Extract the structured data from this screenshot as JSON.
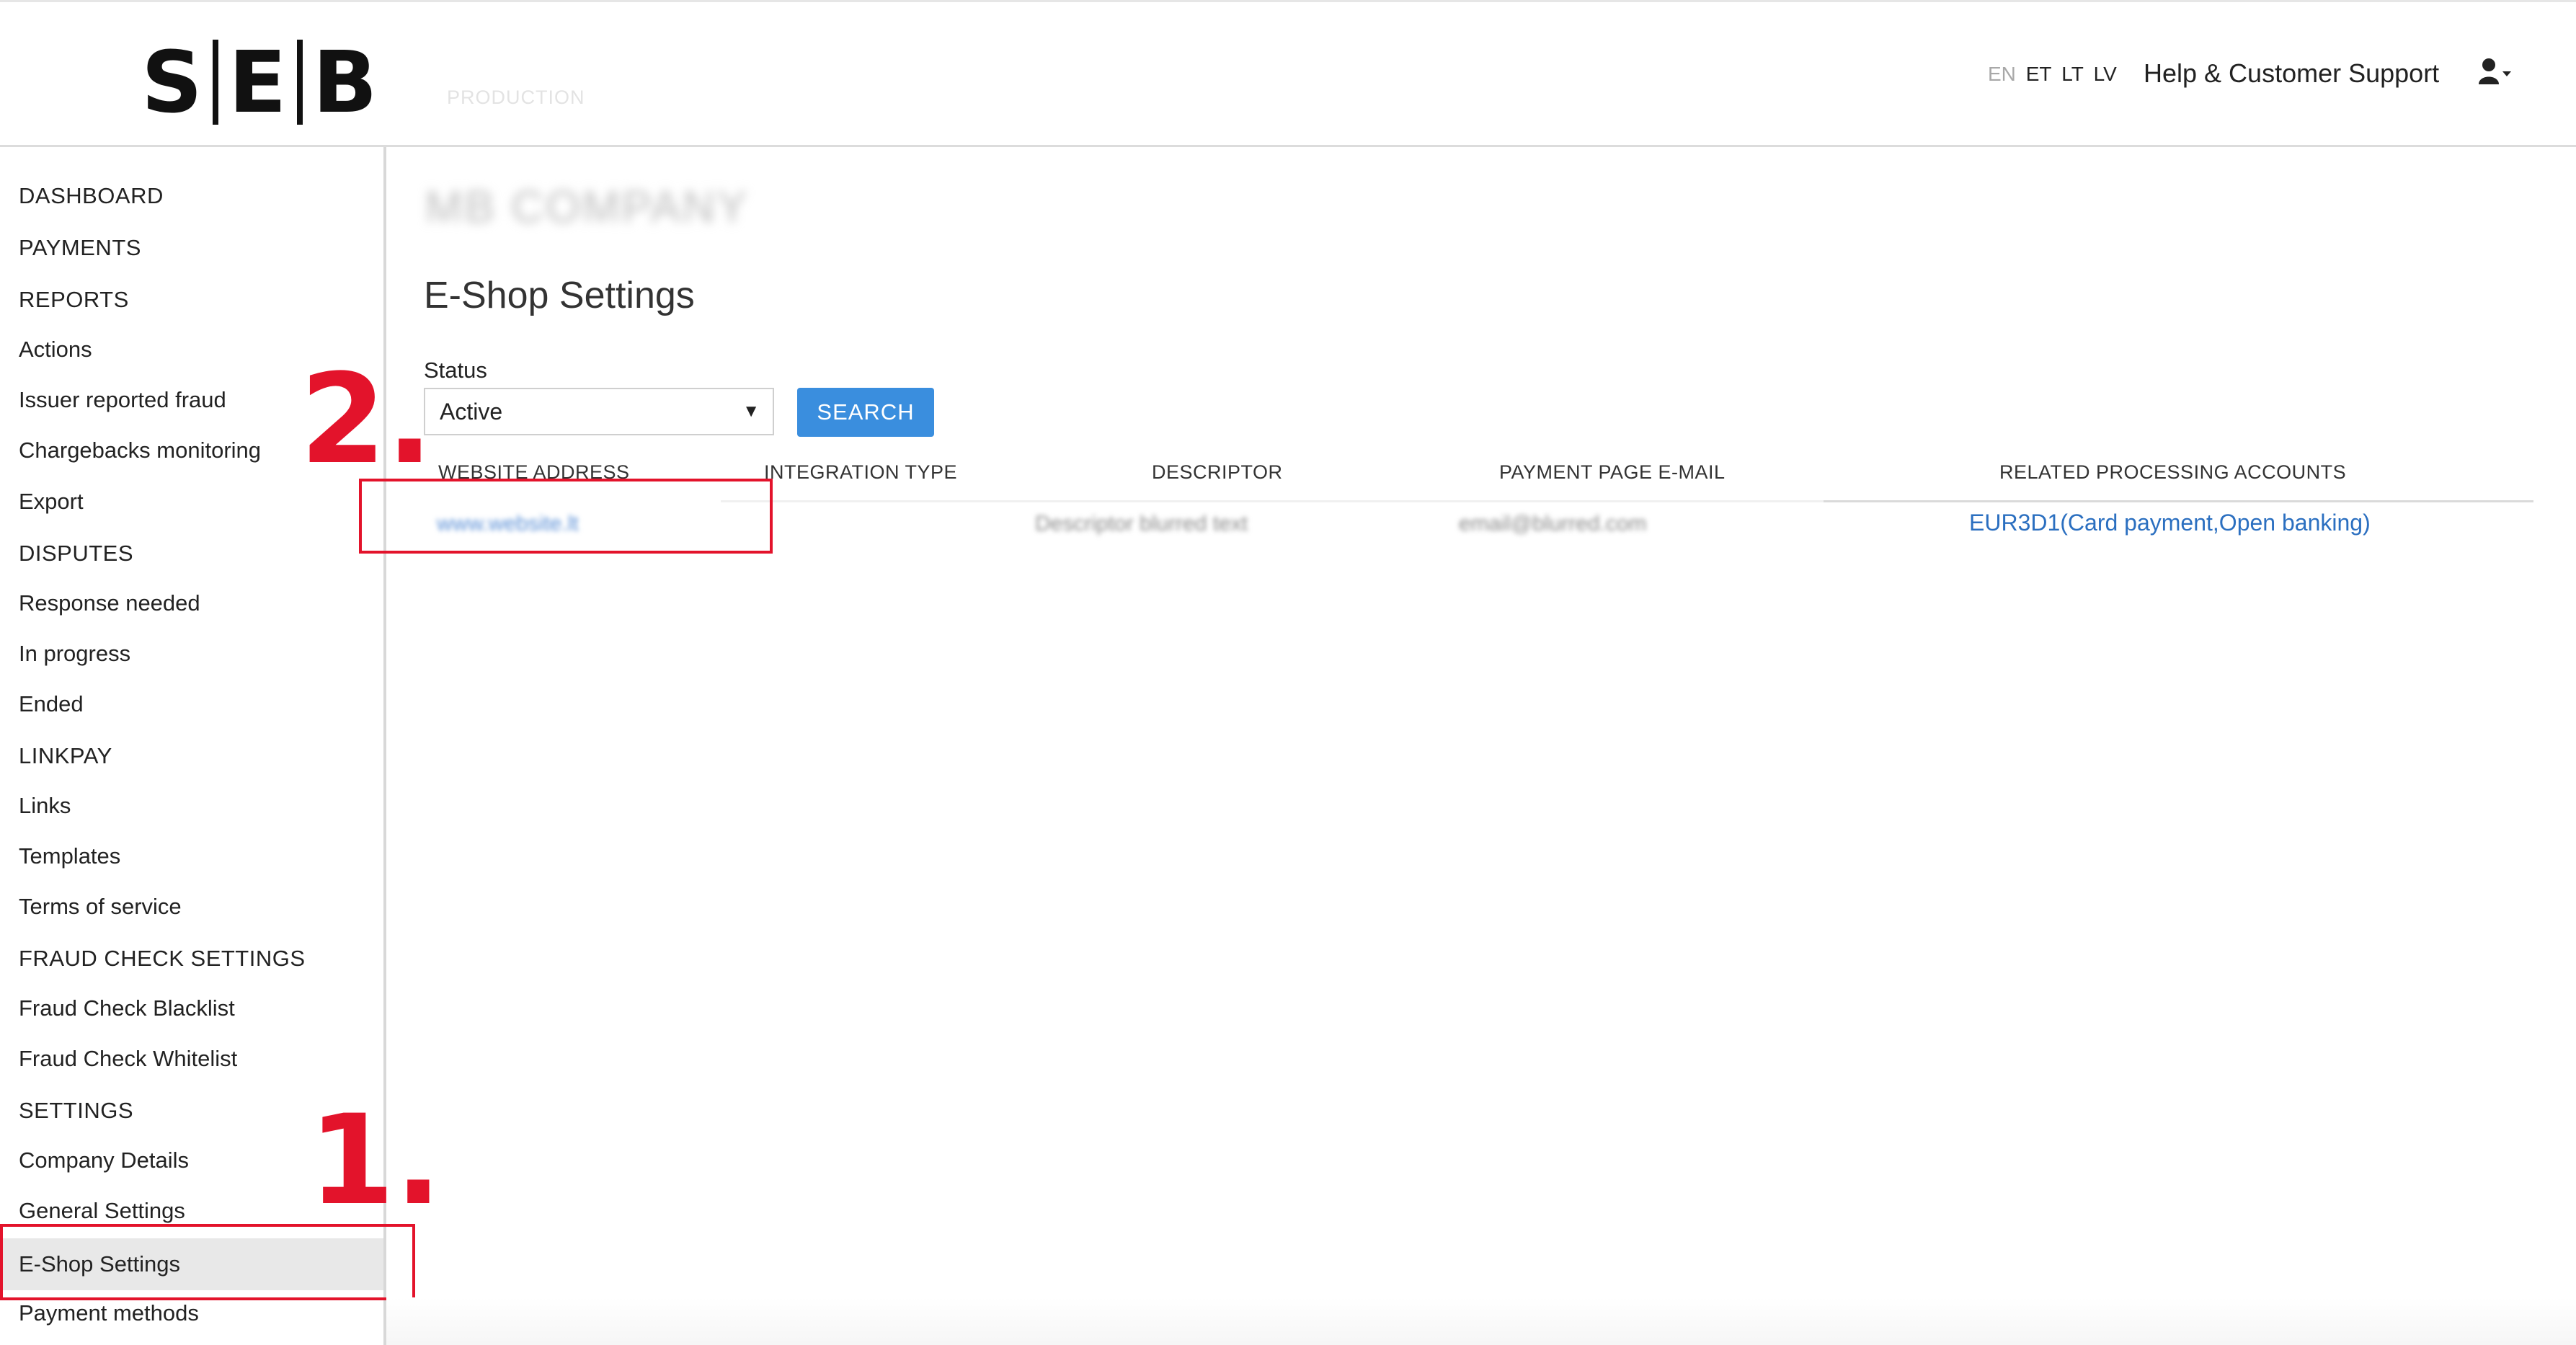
{
  "header": {
    "logo": {
      "left": "S",
      "mid": "E",
      "right": "B"
    },
    "environment": "PRODUCTION",
    "languages": [
      "EN",
      "ET",
      "LT",
      "LV"
    ],
    "active_language": "EN",
    "help_link": "Help & Customer Support",
    "user_icon": "user-icon"
  },
  "sidebar": {
    "items": [
      {
        "label": "DASHBOARD",
        "type": "section"
      },
      {
        "label": "PAYMENTS",
        "type": "section"
      },
      {
        "label": "REPORTS",
        "type": "section"
      },
      {
        "label": "Actions",
        "type": "item"
      },
      {
        "label": "Issuer reported fraud",
        "type": "item"
      },
      {
        "label": "Chargebacks monitoring",
        "type": "item"
      },
      {
        "label": "Export",
        "type": "item"
      },
      {
        "label": "DISPUTES",
        "type": "section"
      },
      {
        "label": "Response needed",
        "type": "item"
      },
      {
        "label": "In progress",
        "type": "item"
      },
      {
        "label": "Ended",
        "type": "item"
      },
      {
        "label": "LINKPAY",
        "type": "section"
      },
      {
        "label": "Links",
        "type": "item"
      },
      {
        "label": "Templates",
        "type": "item"
      },
      {
        "label": "Terms of service",
        "type": "item"
      },
      {
        "label": "FRAUD CHECK SETTINGS",
        "type": "section"
      },
      {
        "label": "Fraud Check Blacklist",
        "type": "item"
      },
      {
        "label": "Fraud Check Whitelist",
        "type": "item"
      },
      {
        "label": "SETTINGS",
        "type": "section"
      },
      {
        "label": "Company Details",
        "type": "item"
      },
      {
        "label": "General Settings",
        "type": "item"
      },
      {
        "label": "E-Shop Settings",
        "type": "item",
        "selected": true
      },
      {
        "label": "Payment methods",
        "type": "item"
      }
    ]
  },
  "main": {
    "company_name_blurred": "MB COMPANY",
    "title": "E-Shop Settings",
    "status_label": "Status",
    "status_value": "Active",
    "search_button": "SEARCH",
    "table": {
      "headers": [
        "WEBSITE ADDRESS",
        "INTEGRATION TYPE",
        "DESCRIPTOR",
        "PAYMENT PAGE E-MAIL",
        "RELATED PROCESSING ACCOUNTS"
      ],
      "rows": [
        {
          "website": "www.website.lt",
          "integration_type": "",
          "descriptor": "Descriptor blurred text",
          "email": "email@blurred.com",
          "related_accounts": "EUR3D1(Card payment,Open banking)"
        }
      ]
    }
  },
  "annotations": {
    "step1": "1.",
    "step2": "2."
  },
  "colors": {
    "accent_button": "#3a8ede",
    "link": "#2b6fc0",
    "annotation_red": "#e3132b",
    "selected_bg": "#e8e8e8"
  }
}
